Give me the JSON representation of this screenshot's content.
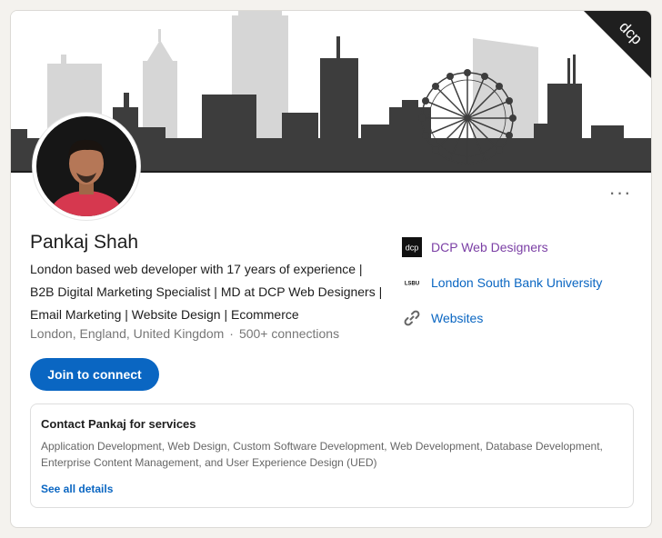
{
  "profile": {
    "name": "Pankaj Shah",
    "headline": "London based web developer with 17 years of experience | B2B Digital Marketing Specialist | MD at DCP Web Designers | Email Marketing | Website Design | Ecommerce",
    "location": "London, England, United Kingdom",
    "separator": "·",
    "connections": "500+ connections"
  },
  "banner": {
    "corner_logo_text": "dcp"
  },
  "actions": {
    "connect_label": "Join to connect",
    "more_label": "···"
  },
  "sidebar": {
    "items": [
      {
        "icon": "dcp-logo-icon",
        "icon_text": "dcp",
        "label": "DCP Web Designers",
        "color": "#7b3fa5"
      },
      {
        "icon": "lsbu-logo-icon",
        "icon_text": "LSBU",
        "label": "London South Bank University",
        "color": "#0a66c2"
      },
      {
        "icon": "link-icon",
        "label": "Websites",
        "color": "#0a66c2"
      }
    ]
  },
  "services": {
    "title": "Contact Pankaj for services",
    "list": "Application Development, Web Design, Custom Software Development, Web Development, Database Development, Enterprise Content Management, and User Experience Design (UED)",
    "see_all": "See all details"
  },
  "colors": {
    "primary": "#0a66c2",
    "text": "#1d1d1d",
    "muted": "#767676",
    "dcp_purple": "#7b3fa5"
  }
}
